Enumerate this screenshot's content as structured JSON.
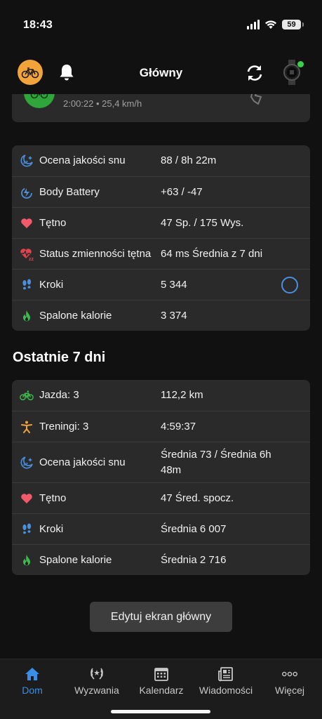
{
  "status_bar": {
    "time": "18:43",
    "battery": "59"
  },
  "header": {
    "title": "Główny"
  },
  "activity": {
    "meta": "2:00:22 • 25,4 km/h"
  },
  "today": {
    "rows": [
      {
        "icon": "sleep-icon",
        "label": "Ocena jakości snu",
        "value": "88 / 8h 22m"
      },
      {
        "icon": "body-battery-icon",
        "label": "Body Battery",
        "value": "+63 / -47"
      },
      {
        "icon": "heart-icon",
        "label": "Tętno",
        "value": "47 Sp. / 175 Wys."
      },
      {
        "icon": "hrv-icon",
        "label": "Status zmienności tętna",
        "value": "64 ms Średnia z 7 dni"
      },
      {
        "icon": "steps-icon",
        "label": "Kroki",
        "value": "5 344"
      },
      {
        "icon": "flame-icon",
        "label": "Spalone kalorie",
        "value": "3 374"
      }
    ]
  },
  "last7": {
    "title": "Ostatnie 7 dni",
    "rows": [
      {
        "icon": "bike-icon",
        "label": "Jazda: 3",
        "value": "112,2 km"
      },
      {
        "icon": "workout-icon",
        "label": "Treningi: 3",
        "value": "4:59:37"
      },
      {
        "icon": "sleep-icon",
        "label": "Ocena jakości snu",
        "value": "Średnia 73 / Średnia 6h 48m"
      },
      {
        "icon": "heart-icon",
        "label": "Tętno",
        "value": "47 Śred. spocz."
      },
      {
        "icon": "steps-icon",
        "label": "Kroki",
        "value": "Średnia 6 007"
      },
      {
        "icon": "flame-icon",
        "label": "Spalone kalorie",
        "value": "Średnia 2 716"
      }
    ]
  },
  "edit_button": "Edytuj ekran główny",
  "tabs": [
    {
      "icon": "home-icon",
      "label": "Dom"
    },
    {
      "icon": "laurel-icon",
      "label": "Wyzwania"
    },
    {
      "icon": "calendar-icon",
      "label": "Kalendarz"
    },
    {
      "icon": "news-icon",
      "label": "Wiadomości"
    },
    {
      "icon": "more-icon",
      "label": "Więcej"
    }
  ],
  "colors": {
    "accent": "#3a8ee6",
    "background": "#111111",
    "card": "#2a2a2a",
    "activity_green": "#2fa53a",
    "avatar_orange": "#f2a33a"
  }
}
